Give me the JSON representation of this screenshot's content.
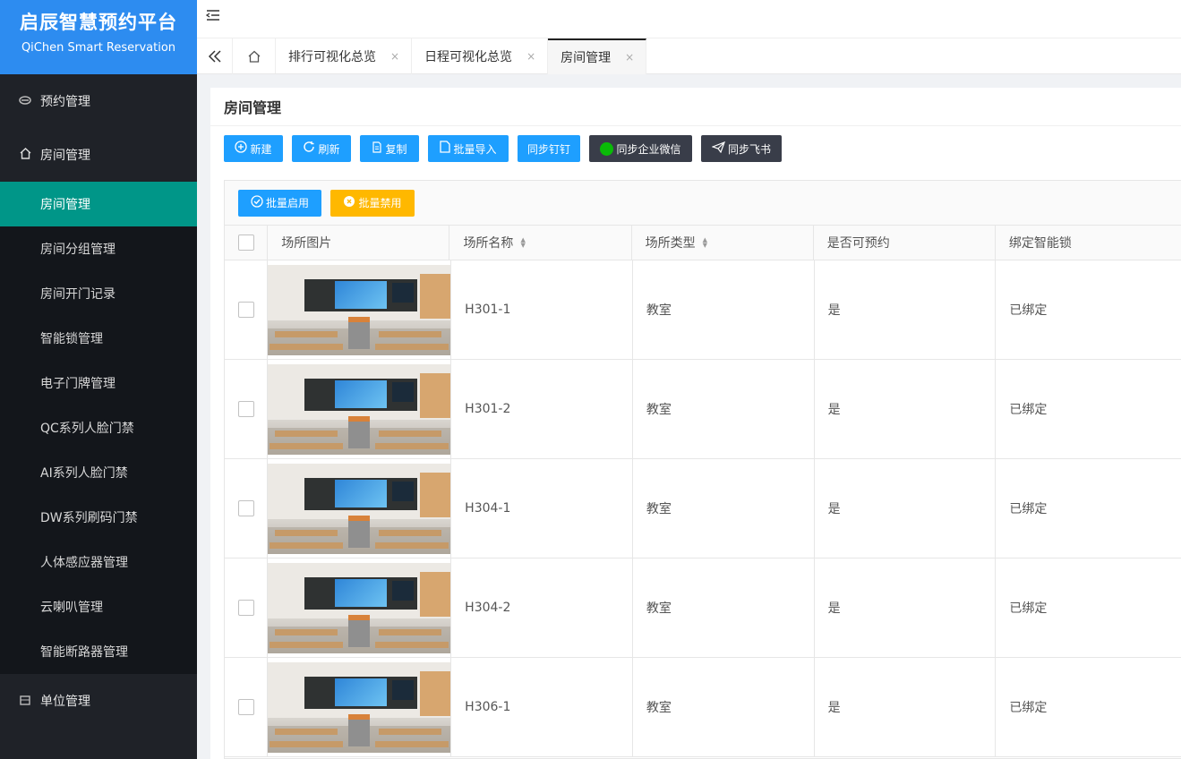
{
  "brand": {
    "title": "启辰智慧预约平台",
    "subtitle": "QiChen Smart Reservation"
  },
  "sidebar": {
    "groups": [
      {
        "label": "预约管理",
        "icon": "appointment-icon"
      },
      {
        "label": "房间管理",
        "icon": "home-icon"
      }
    ],
    "sub_items": [
      {
        "label": "房间管理",
        "active": true
      },
      {
        "label": "房间分组管理"
      },
      {
        "label": "房间开门记录"
      },
      {
        "label": "智能锁管理"
      },
      {
        "label": "电子门牌管理"
      },
      {
        "label": "QC系列人脸门禁"
      },
      {
        "label": "AI系列人脸门禁"
      },
      {
        "label": "DW系列刷码门禁"
      },
      {
        "label": "人体感应器管理"
      },
      {
        "label": "云喇叭管理"
      },
      {
        "label": "智能断路器管理"
      }
    ],
    "bottom_group": {
      "label": "单位管理",
      "icon": "building-icon"
    }
  },
  "tabs": {
    "items": [
      {
        "label": "排行可视化总览"
      },
      {
        "label": "日程可视化总览"
      },
      {
        "label": "房间管理",
        "active": true
      }
    ],
    "close_glyph": "×"
  },
  "page": {
    "title": "房间管理"
  },
  "toolbar": {
    "new": "新建",
    "refresh": "刷新",
    "copy": "复制",
    "import": "批量导入",
    "sync_dingtalk": "同步钉钉",
    "sync_wecom": "同步企业微信",
    "sync_feishu": "同步飞书"
  },
  "batch": {
    "enable": "批量启用",
    "disable": "批量禁用"
  },
  "table": {
    "headers": [
      "场所图片",
      "场所名称",
      "场所类型",
      "是否可预约",
      "绑定智能锁"
    ],
    "rows": [
      {
        "name": "H301-1",
        "type": "教室",
        "bookable": "是",
        "lock": "已绑定"
      },
      {
        "name": "H301-2",
        "type": "教室",
        "bookable": "是",
        "lock": "已绑定"
      },
      {
        "name": "H304-1",
        "type": "教室",
        "bookable": "是",
        "lock": "已绑定"
      },
      {
        "name": "H304-2",
        "type": "教室",
        "bookable": "是",
        "lock": "已绑定"
      },
      {
        "name": "H306-1",
        "type": "教室",
        "bookable": "是",
        "lock": "已绑定"
      }
    ]
  },
  "colors": {
    "brand": "#2d8cf0",
    "sidebar_bg": "#1f2228",
    "active_item": "#009688",
    "primary_button": "#1e9fff",
    "dark_button": "#393d49",
    "warn_button": "#ffb800"
  }
}
